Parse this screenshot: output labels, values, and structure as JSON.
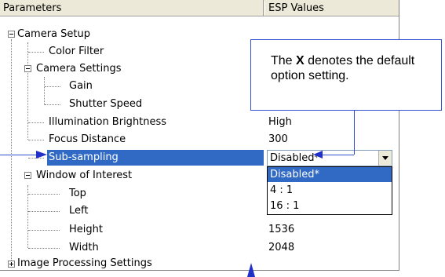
{
  "header": {
    "parameters": "Parameters",
    "esp_values": "ESP Values"
  },
  "tree": {
    "camera_setup": "Camera Setup",
    "color_filter": "Color Filter",
    "camera_settings": "Camera Settings",
    "gain": "Gain",
    "shutter_speed": "Shutter Speed",
    "illumination_brightness": "Illumination Brightness",
    "illumination_brightness_value": "High",
    "focus_distance": "Focus Distance",
    "focus_distance_value": "300",
    "sub_sampling": "Sub-sampling",
    "window_of_interest": "Window of Interest",
    "top": "Top",
    "left": "Left",
    "height": "Height",
    "height_value": "1536",
    "width": "Width",
    "width_value": "2048",
    "image_processing_settings": "Image Processing Settings"
  },
  "combo": {
    "selected": "Disabled*"
  },
  "dropdown": {
    "options": [
      "Disabled*",
      "4 : 1",
      "16 : 1"
    ]
  },
  "callout": {
    "pre": "The ",
    "bold": "X",
    "post": " denotes the default option setting."
  },
  "colors": {
    "selection": "#316ac5",
    "callout_border": "#3050d0",
    "arrow": "#2030c8"
  }
}
